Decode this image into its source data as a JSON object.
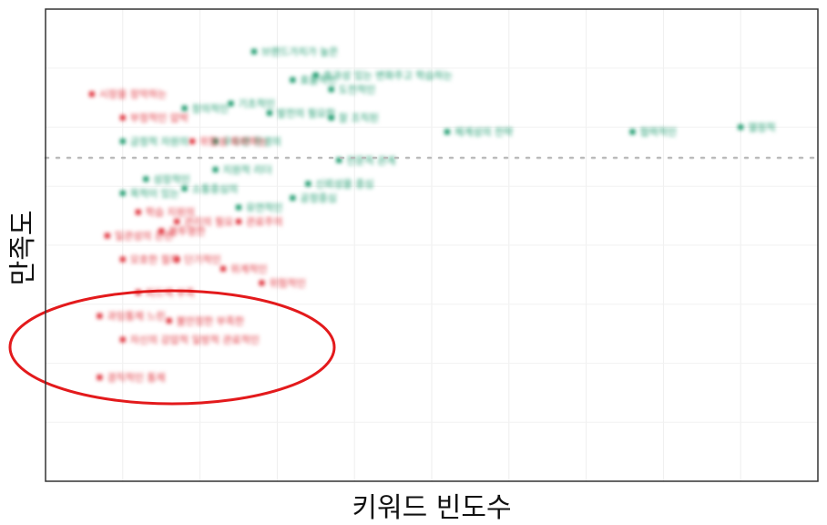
{
  "chart_data": {
    "type": "scatter",
    "title": "",
    "xlabel": "키워드 빈도수",
    "ylabel": "만족도",
    "xlim": [
      0,
      100
    ],
    "ylim": [
      0,
      100
    ],
    "grid": true,
    "tick_labels_visible": false,
    "reference_line": {
      "axis": "y",
      "value": 68.5,
      "style": "dotted"
    },
    "highlight": {
      "shape": "ellipse",
      "color": "#e31a1c",
      "around": "low-satisfaction keywords"
    },
    "series": [
      {
        "color": "#1a9a6c",
        "points": [
          {
            "x": 27,
            "y": 91,
            "label": "브랜드가치가 높은"
          },
          {
            "x": 32,
            "y": 85,
            "label": "효율적인"
          },
          {
            "x": 35,
            "y": 86,
            "label": "효과성 있는 변화주고 학습하는"
          },
          {
            "x": 37,
            "y": 83,
            "label": "도전적인"
          },
          {
            "x": 24,
            "y": 80,
            "label": "기초적인"
          },
          {
            "x": 18,
            "y": 79,
            "label": "창의적인"
          },
          {
            "x": 29,
            "y": 78,
            "label": "발전의 필요한"
          },
          {
            "x": 37,
            "y": 77,
            "label": "잘 조직된"
          },
          {
            "x": 52,
            "y": 74,
            "label": "체계성의 전략"
          },
          {
            "x": 76,
            "y": 74,
            "label": "협력적인"
          },
          {
            "x": 90,
            "y": 75,
            "label": "열정적"
          },
          {
            "x": 10,
            "y": 72,
            "label": "긍정적 자원의"
          },
          {
            "x": 22,
            "y": 72,
            "label": "우수한 환경의"
          },
          {
            "x": 38,
            "y": 68,
            "label": "전문적 관계"
          },
          {
            "x": 13,
            "y": 64,
            "label": "성장적인"
          },
          {
            "x": 22,
            "y": 66,
            "label": "지원적 리더"
          },
          {
            "x": 34,
            "y": 63,
            "label": "신뢰성을 중심"
          },
          {
            "x": 10,
            "y": 61,
            "label": "목적이 있는"
          },
          {
            "x": 18,
            "y": 62,
            "label": "소통중심의"
          },
          {
            "x": 25,
            "y": 58,
            "label": "유연적인"
          },
          {
            "x": 32,
            "y": 60,
            "label": "공정중심"
          }
        ]
      },
      {
        "color": "#e0303a",
        "points": [
          {
            "x": 6,
            "y": 82,
            "label": "시장을 장악하는"
          },
          {
            "x": 10,
            "y": 77,
            "label": "부정적인 압박"
          },
          {
            "x": 19,
            "y": 72,
            "label": "위험성 회피하는"
          },
          {
            "x": 12,
            "y": 57,
            "label": "학습 지원의"
          },
          {
            "x": 17,
            "y": 55,
            "label": "관리의 필요"
          },
          {
            "x": 8,
            "y": 52,
            "label": "일관성의 관련"
          },
          {
            "x": 15,
            "y": 53,
            "label": "불투명한"
          },
          {
            "x": 25,
            "y": 55,
            "label": "관료주의"
          },
          {
            "x": 10,
            "y": 47,
            "label": "모호한 절차"
          },
          {
            "x": 17,
            "y": 47,
            "label": "단기적인"
          },
          {
            "x": 23,
            "y": 45,
            "label": "위계적인"
          },
          {
            "x": 28,
            "y": 42,
            "label": "위험적인"
          },
          {
            "x": 12,
            "y": 40,
            "label": "피드백 부족"
          },
          {
            "x": 7,
            "y": 35,
            "label": "과잉통제 느린"
          },
          {
            "x": 16,
            "y": 34,
            "label": "불안정한 부족한"
          },
          {
            "x": 10,
            "y": 30,
            "label": "자신의 강압적 일방적 관료적인"
          },
          {
            "x": 7,
            "y": 22,
            "label": "경직적인 통제"
          }
        ]
      }
    ]
  }
}
